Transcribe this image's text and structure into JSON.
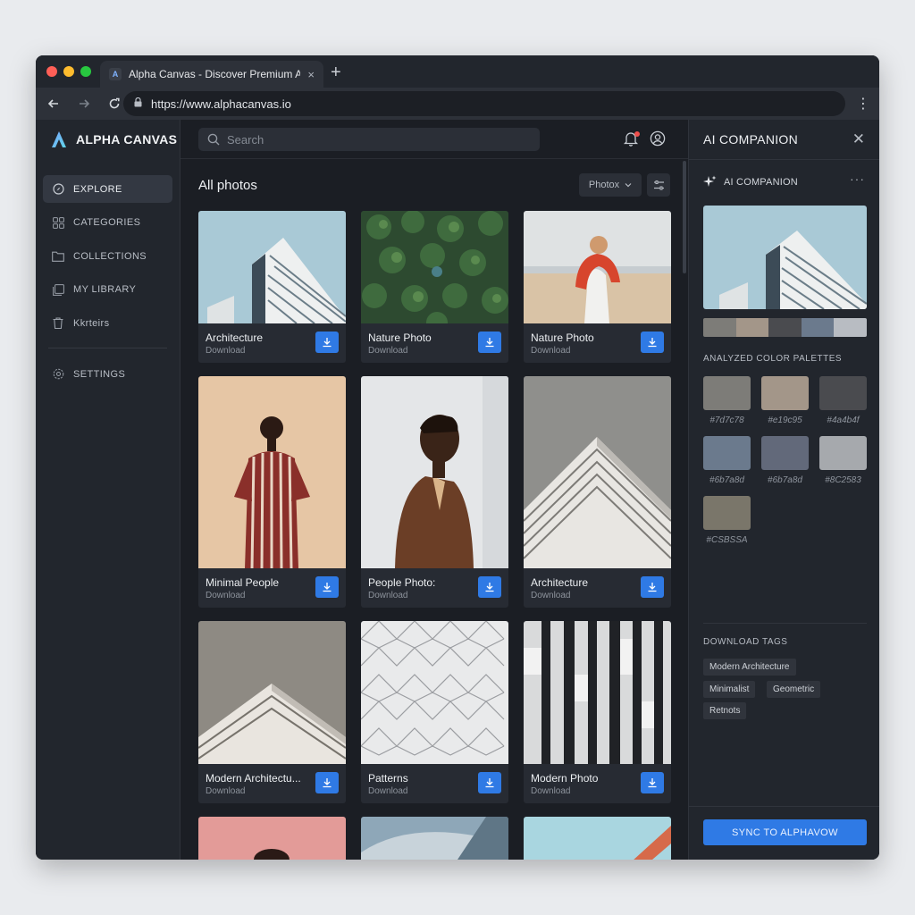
{
  "browser": {
    "tab_title": "Alpha Canvas - Discover Premium Assets",
    "tab_favicon": "A",
    "tab_close": "×",
    "new_tab": "+",
    "url": "https://www.alphacanvas.io"
  },
  "app": {
    "brand": "ALPHA CANVAS",
    "accent": "#2f7ae5"
  },
  "sidebar": {
    "items": [
      {
        "label": "EXPLORE",
        "icon": "compass-icon",
        "active": true
      },
      {
        "label": "CATEGORIES",
        "icon": "grid-icon",
        "active": false
      },
      {
        "label": "COLLECTIONS",
        "icon": "folder-icon",
        "active": false
      },
      {
        "label": "MY LIBRARY",
        "icon": "library-icon",
        "active": false
      },
      {
        "label": "Kkrteirs",
        "icon": "trash-icon",
        "active": false
      }
    ],
    "settings_label": "SETTINGS"
  },
  "topbar": {
    "search_placeholder": "Search"
  },
  "main": {
    "section_title": "All photos",
    "filter_label": "Photox",
    "photos": [
      {
        "title": "Architecture",
        "subtitle": "Download"
      },
      {
        "title": "Nature Photo",
        "subtitle": "Download"
      },
      {
        "title": "Nature Photo",
        "subtitle": "Download"
      },
      {
        "title": "Minimal People",
        "subtitle": "Download"
      },
      {
        "title": "People Photo:",
        "subtitle": "Download"
      },
      {
        "title": "Architecture",
        "subtitle": "Download"
      },
      {
        "title": "Modern Architectu...",
        "subtitle": "Download"
      },
      {
        "title": "Patterns",
        "subtitle": "Download"
      },
      {
        "title": "Modern Photo",
        "subtitle": "Download"
      }
    ]
  },
  "panel": {
    "title": "AI COMPANION",
    "subtitle": "AI COMPANION",
    "more": "···",
    "palette_strip": [
      "#7d7c78",
      "#a39689",
      "#4a4b4f",
      "#6b7a8d",
      "#b8bcc2"
    ],
    "palettes_label": "ANALYZED COLOR PALETTES",
    "swatches": [
      {
        "hex": "#7d7c78",
        "color": "#7d7c78"
      },
      {
        "hex": "#e19c95",
        "color": "#a39689"
      },
      {
        "hex": "#4a4b4f",
        "color": "#4a4b4f"
      },
      {
        "hex": "#6b7a8d",
        "color": "#6b7a8d"
      },
      {
        "hex": "#6b7a8d",
        "color": "#62697a"
      },
      {
        "hex": "#8C2583",
        "color": "#a6a9ad"
      },
      {
        "hex": "#CSBSSA",
        "color": "#7a766a"
      }
    ],
    "tags_label": "DOWNLOAD TAGS",
    "tags": [
      "Modern Architecture",
      "Minimalist",
      "Geometric",
      "Retnots"
    ],
    "sync_button": "SYNC TO ALPHAVOW"
  }
}
